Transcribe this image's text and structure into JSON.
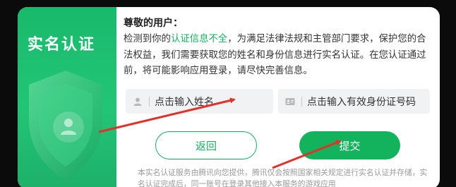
{
  "panel": {
    "title": "实名认证"
  },
  "content": {
    "greeting": "尊敬的用户：",
    "notice_before": "检测到你的",
    "notice_highlight": "认证信息不全",
    "notice_after": "，为满足法律法规和主管部门要求，保护您的合法权益，我们需要获取您的姓名和身份信息进行实名认证。在您认证通过前，将可能影响应用登录，请尽快完善信息。"
  },
  "inputs": {
    "name_placeholder": "点击输入姓名",
    "id_placeholder": "点击输入有效身份证号码"
  },
  "buttons": {
    "back": "返回",
    "submit": "提交"
  },
  "footer": "本实名认证服务由腾讯向您提供，腾讯仅会按照国家相关规定进行实名认证并存储，实名认证完成后，同一账号在登录其他接入本服务的游戏应用",
  "colors": {
    "brand_green": "#1aad62",
    "annotation_red": "#e0322b"
  }
}
